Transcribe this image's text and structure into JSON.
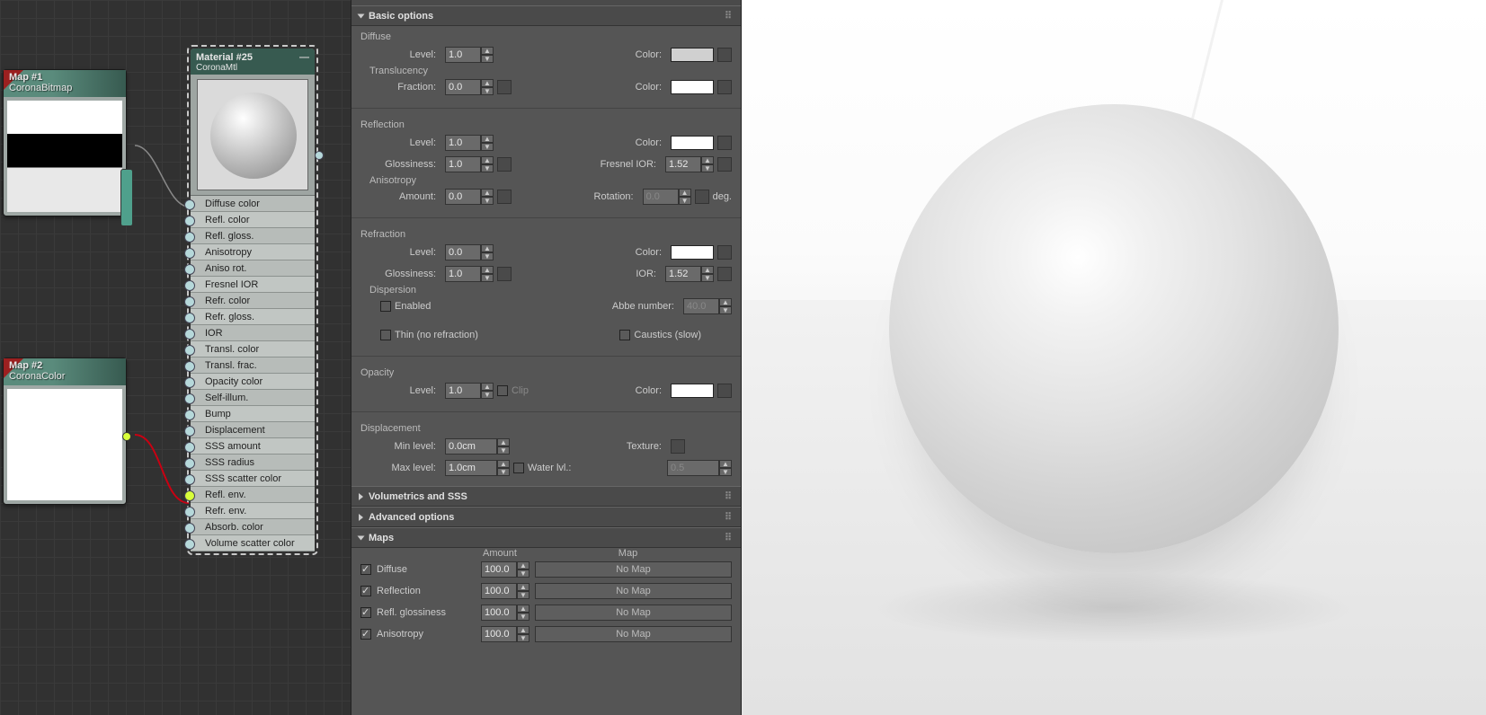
{
  "nodes": {
    "map1": {
      "title": "Map #1",
      "type": "CoronaBitmap"
    },
    "map2": {
      "title": "Map #2",
      "type": "CoronaColor"
    },
    "material": {
      "title": "Material #25",
      "type": "CoronaMtl",
      "slots": [
        "Diffuse color",
        "Refl. color",
        "Refl. gloss.",
        "Anisotropy",
        "Aniso rot.",
        "Fresnel IOR",
        "Refr. color",
        "Refr. gloss.",
        "IOR",
        "Transl. color",
        "Transl. frac.",
        "Opacity color",
        "Self-illum.",
        "Bump",
        "Displacement",
        "SSS amount",
        "SSS radius",
        "SSS scatter color",
        "Refl. env.",
        "Refr. env.",
        "Absorb. color",
        "Volume scatter color"
      ]
    }
  },
  "sections": {
    "basic": "Basic options",
    "volumetrics": "Volumetrics and SSS",
    "advanced": "Advanced options",
    "maps_title": "Maps"
  },
  "basic": {
    "diffuse": {
      "title": "Diffuse",
      "level_lbl": "Level:",
      "level": "1.0",
      "color_lbl": "Color:",
      "color": "#d0d0d0"
    },
    "translucency": {
      "title": "Translucency",
      "fraction_lbl": "Fraction:",
      "fraction": "0.0",
      "color_lbl": "Color:",
      "color": "#ffffff"
    },
    "reflection": {
      "title": "Reflection",
      "level_lbl": "Level:",
      "level": "1.0",
      "color_lbl": "Color:",
      "color": "#ffffff",
      "gloss_lbl": "Glossiness:",
      "gloss": "1.0",
      "fresnel_lbl": "Fresnel IOR:",
      "fresnel": "1.52",
      "aniso_title": "Anisotropy",
      "amount_lbl": "Amount:",
      "amount": "0.0",
      "rotation_lbl": "Rotation:",
      "rotation": "0.0",
      "deg": "deg."
    },
    "refraction": {
      "title": "Refraction",
      "level_lbl": "Level:",
      "level": "0.0",
      "color_lbl": "Color:",
      "color": "#ffffff",
      "gloss_lbl": "Glossiness:",
      "gloss": "1.0",
      "ior_lbl": "IOR:",
      "ior": "1.52",
      "dispersion_title": "Dispersion",
      "enabled_lbl": "Enabled",
      "abbe_lbl": "Abbe number:",
      "abbe": "40.0",
      "thin_lbl": "Thin (no refraction)",
      "caustics_lbl": "Caustics (slow)"
    },
    "opacity": {
      "title": "Opacity",
      "level_lbl": "Level:",
      "level": "1.0",
      "clip_lbl": "Clip",
      "color_lbl": "Color:",
      "color": "#ffffff"
    },
    "displacement": {
      "title": "Displacement",
      "min_lbl": "Min level:",
      "min": "0.0cm",
      "tex_lbl": "Texture:",
      "max_lbl": "Max level:",
      "max": "1.0cm",
      "water_lbl": "Water lvl.:",
      "water": "0.5"
    }
  },
  "maps": {
    "amount_hdr": "Amount",
    "map_hdr": "Map",
    "rows": [
      {
        "name": "Diffuse",
        "amount": "100.0",
        "map": "No Map"
      },
      {
        "name": "Reflection",
        "amount": "100.0",
        "map": "No Map"
      },
      {
        "name": "Refl. glossiness",
        "amount": "100.0",
        "map": "No Map"
      },
      {
        "name": "Anisotropy",
        "amount": "100.0",
        "map": "No Map"
      }
    ]
  }
}
